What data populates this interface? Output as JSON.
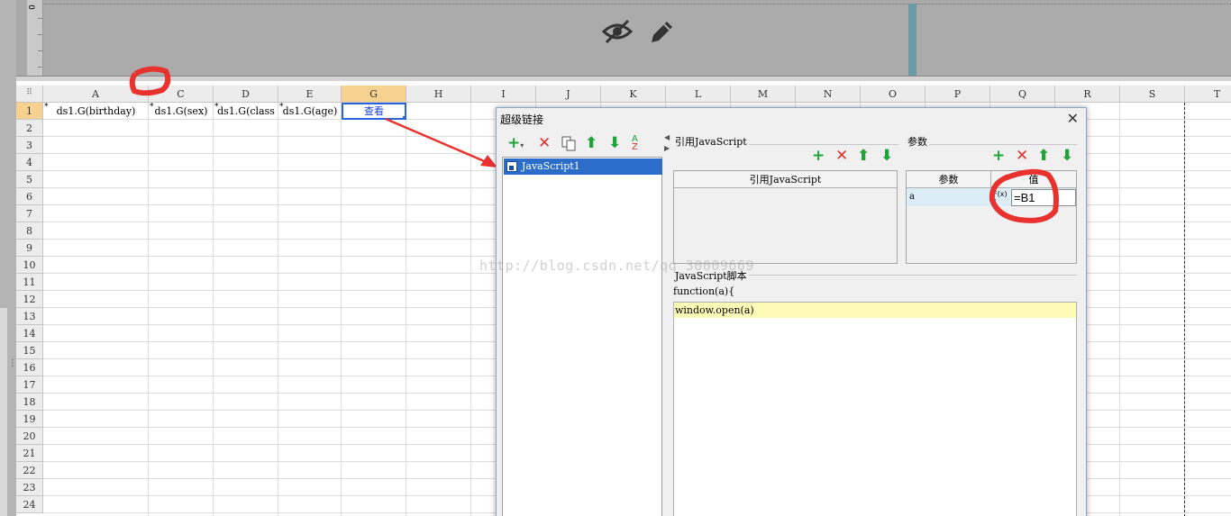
{
  "preview": {
    "ruler_label": "0",
    "icons": [
      "eye-slash-icon",
      "pencil-icon"
    ]
  },
  "sheet": {
    "columns": [
      "A",
      "C",
      "D",
      "E",
      "G",
      "H",
      "I",
      "J",
      "K",
      "L",
      "M",
      "N",
      "O",
      "P",
      "Q",
      "R",
      "S",
      "T"
    ],
    "selected_column": "G",
    "rows": [
      "1",
      "2",
      "3",
      "4",
      "5",
      "6",
      "7",
      "8",
      "9",
      "10",
      "11",
      "12",
      "13",
      "14",
      "15",
      "16",
      "17",
      "18",
      "19",
      "20",
      "21",
      "22",
      "23",
      "24"
    ],
    "selected_row": "1",
    "row1": {
      "A": "ds1.G(birthday)",
      "C": "ds1.G(sex)",
      "D": "ds1.G(class",
      "E": "ds1.G(age)",
      "G": "查看"
    },
    "flag": "*"
  },
  "dialog": {
    "title": "超级链接",
    "left_list": {
      "items": [
        "JavaScript1"
      ],
      "selected": "JavaScript1"
    },
    "ref_section": {
      "group_label": "引用JavaScript",
      "table_header": "引用JavaScript"
    },
    "params_section": {
      "group_label": "参数",
      "columns": [
        "参数",
        "值"
      ],
      "rows": [
        {
          "name": "a",
          "fx": "F(x)",
          "value": "=B1"
        }
      ]
    },
    "script_section": {
      "group_label": "JavaScript脚本",
      "signature": "function(a){",
      "lines": [
        "window.open(a)"
      ]
    }
  },
  "watermark": "http://blog.csdn.net/qq_30009669",
  "annotation_color": "#e8322e"
}
